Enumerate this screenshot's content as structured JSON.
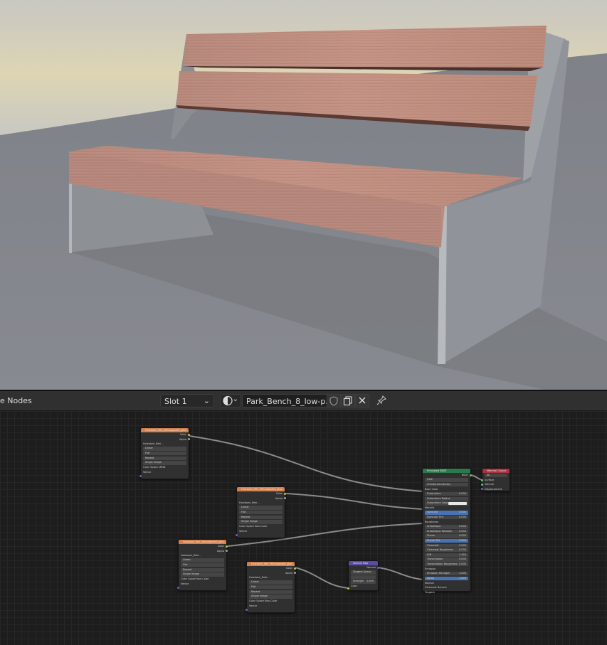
{
  "header": {
    "title_fragment": "e Nodes",
    "slot_label": "Slot 1",
    "slot_dropdown_glyph": "⌄",
    "material_dropdown_glyph": "⌄",
    "material_name": "Park_Bench_8_low-p...",
    "material_preview_icon": "sphere-icon",
    "fake_user_icon": "shield-icon",
    "duplicate_icon": "copy-icon",
    "unlink_icon": "close-icon",
    "pin_icon": "pin-icon"
  },
  "colors": {
    "image_texture_header": "#d17f4c",
    "principled_header": "#2c7a4c",
    "normal_map_header": "#5b4aa6",
    "output_header": "#a83240",
    "wire": "#8a8a8a",
    "socket_color": "#c7c729",
    "socket_float": "#a1a1a1",
    "socket_vector": "#6363c7",
    "socket_shader": "#63c763"
  },
  "image_nodes": [
    {
      "title": "Holzbank_Rek_Metallgestell_glos...",
      "image": "Holzbank_Reki...",
      "outputs": [
        "Color",
        "Alpha"
      ],
      "interpolation": "Linear",
      "projection": "Flat",
      "extension": "Repeat",
      "source": "Single Image",
      "color_space_label": "Color Space",
      "color_space": "sRGB",
      "vector_label": "Vector"
    },
    {
      "title": "Holzbank_Rek_Metallgestell_glos...",
      "image": "Holzbank_Reki...",
      "outputs": [
        "Color",
        "Alpha"
      ],
      "interpolation": "Linear",
      "projection": "Flat",
      "extension": "Repeat",
      "source": "Single Image",
      "color_space_label": "Color Space",
      "color_space": "Non-Color",
      "vector_label": "Vector"
    },
    {
      "title": "Holzbank_Rek_Metallgestell_glos...",
      "image": "Holzbank_Reki...",
      "outputs": [
        "Color",
        "Alpha"
      ],
      "interpolation": "Linear",
      "projection": "Flat",
      "extension": "Repeat",
      "source": "Single Image",
      "color_space_label": "Color Space",
      "color_space": "Non-Color",
      "vector_label": "Vector"
    },
    {
      "title": "Holzbank_Rek_Metallgestell_glos...",
      "image": "Holzbank_Reki...",
      "outputs": [
        "Color",
        "Alpha"
      ],
      "interpolation": "Linear",
      "projection": "Flat",
      "extension": "Repeat",
      "source": "Single Image",
      "color_space_label": "Color Space",
      "color_space": "Non-Color",
      "vector_label": "Vector"
    }
  ],
  "normal_map": {
    "title": "Normal Map",
    "output": "Normal",
    "space": "Tangent Space",
    "strength_label": "Strength",
    "strength": "1.000",
    "color_input": "Color"
  },
  "principled": {
    "title": "Principled BSDF",
    "output": "BSDF",
    "distribution": "GGX",
    "subsurface_method": "Christensen-Burley",
    "rows": [
      {
        "label": "Base Color",
        "value": "",
        "kind": "socket"
      },
      {
        "label": "Subsurface",
        "value": "0.000",
        "kind": "field"
      },
      {
        "label": "Subsurface Radius",
        "value": "",
        "kind": "field"
      },
      {
        "label": "Subsurface Color",
        "value": "",
        "kind": "white"
      },
      {
        "label": "Metallic",
        "value": "",
        "kind": "socket"
      },
      {
        "label": "Specular",
        "value": "0.500",
        "kind": "blue"
      },
      {
        "label": "Specular Tint",
        "value": "0.000",
        "kind": "field"
      },
      {
        "label": "Roughness",
        "value": "",
        "kind": "socket"
      },
      {
        "label": "Anisotropic",
        "value": "0.000",
        "kind": "field"
      },
      {
        "label": "Anisotropic Rotation",
        "value": "0.000",
        "kind": "field"
      },
      {
        "label": "Sheen",
        "value": "0.000",
        "kind": "field"
      },
      {
        "label": "Sheen Tint",
        "value": "0.500",
        "kind": "blue"
      },
      {
        "label": "Clearcoat",
        "value": "0.000",
        "kind": "field"
      },
      {
        "label": "Clearcoat Roughness",
        "value": "0.030",
        "kind": "field"
      },
      {
        "label": "IOR",
        "value": "1.450",
        "kind": "field"
      },
      {
        "label": "Transmission",
        "value": "0.000",
        "kind": "field"
      },
      {
        "label": "Transmission Roughness",
        "value": "0.000",
        "kind": "field"
      },
      {
        "label": "Emission",
        "value": "",
        "kind": "socket"
      },
      {
        "label": "Emission Strength",
        "value": "1.000",
        "kind": "field"
      },
      {
        "label": "Alpha",
        "value": "1.000",
        "kind": "blue"
      },
      {
        "label": "Normal",
        "value": "",
        "kind": "socket"
      },
      {
        "label": "Clearcoat Normal",
        "value": "",
        "kind": "socket"
      },
      {
        "label": "Tangent",
        "value": "",
        "kind": "socket"
      }
    ]
  },
  "output_node": {
    "title": "Material Output",
    "target": "All",
    "inputs": [
      "Surface",
      "Volume",
      "Displacement"
    ]
  }
}
